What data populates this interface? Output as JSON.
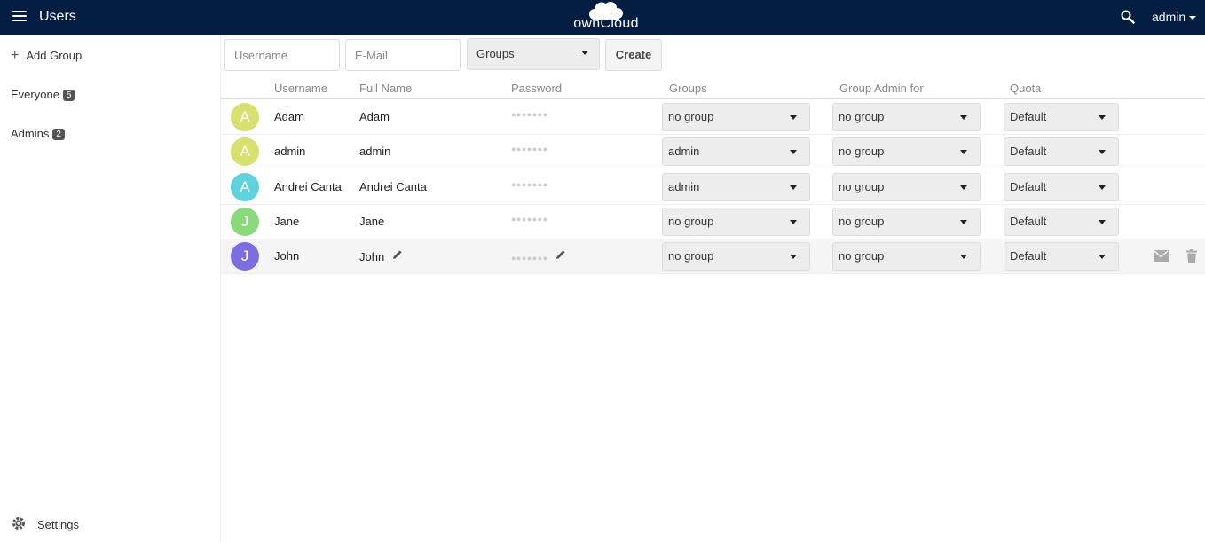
{
  "header": {
    "app_title": "Users",
    "logo_text": "ownCloud",
    "user_menu_label": "admin",
    "icons": [
      "menu-icon",
      "search-icon",
      "caret-down-icon",
      "cloud-logo"
    ]
  },
  "colors": {
    "header_bg": "#041e42",
    "avatar_yellow": "#d8e070",
    "avatar_cyan": "#5fd2dc",
    "avatar_green": "#8ad97a",
    "avatar_purple": "#7a6ee0"
  },
  "sidebar": {
    "add_group_label": "Add Group",
    "groups": [
      {
        "label": "Everyone",
        "count": "5"
      },
      {
        "label": "Admins",
        "count": "2"
      }
    ],
    "settings_label": "Settings"
  },
  "controls": {
    "username_placeholder": "Username",
    "email_placeholder": "E-Mail",
    "groups_label": "Groups",
    "create_label": "Create"
  },
  "table": {
    "headers": {
      "username": "Username",
      "full_name": "Full Name",
      "password": "Password",
      "groups": "Groups",
      "group_admin": "Group Admin for",
      "quota": "Quota"
    },
    "rows": [
      {
        "initial": "A",
        "username": "Adam",
        "full_name": "Adam",
        "password": "●●●●●●●",
        "groups": "no group",
        "group_admin": "no group",
        "quota": "Default"
      },
      {
        "initial": "A",
        "username": "admin",
        "full_name": "admin",
        "password": "●●●●●●●",
        "groups": "admin",
        "group_admin": "no group",
        "quota": "Default"
      },
      {
        "initial": "A",
        "username": "Andrei Canta",
        "full_name": "Andrei Canta",
        "password": "●●●●●●●",
        "groups": "admin",
        "group_admin": "no group",
        "quota": "Default"
      },
      {
        "initial": "J",
        "username": "Jane",
        "full_name": "Jane",
        "password": "●●●●●●●",
        "groups": "no group",
        "group_admin": "no group",
        "quota": "Default"
      },
      {
        "initial": "J",
        "username": "John",
        "full_name": "John",
        "password": "●●●●●●●",
        "groups": "no group",
        "group_admin": "no group",
        "quota": "Default"
      }
    ]
  }
}
